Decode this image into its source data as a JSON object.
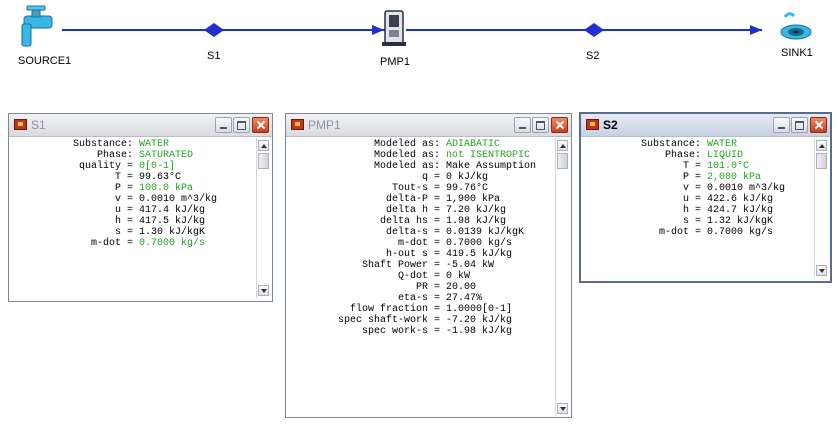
{
  "flowsheet": {
    "nodes": [
      {
        "label": "SOURCE1",
        "icon": "faucet-icon"
      },
      {
        "label": "S1",
        "icon": "stream-diamond-icon"
      },
      {
        "label": "PMP1",
        "icon": "pump-icon"
      },
      {
        "label": "S2",
        "icon": "stream-diamond-icon"
      },
      {
        "label": "SINK1",
        "icon": "drain-icon"
      }
    ],
    "line_color": "#1f2fd1"
  },
  "windows": {
    "s1": {
      "title": "S1",
      "rows": [
        {
          "label": "Substance:",
          "value": "WATER"
        },
        {
          "label": "Phase:",
          "value": "SATURATED"
        },
        {
          "label": "quality =",
          "value": "0[0-1]"
        },
        {
          "label": "T =",
          "value": "99.63°C"
        },
        {
          "label": "P =",
          "value": "100.0 kPa"
        },
        {
          "label": "v =",
          "value": "0.0010 m^3/kg"
        },
        {
          "label": "u =",
          "value": "417.4 kJ/kg"
        },
        {
          "label": "h =",
          "value": "417.5 kJ/kg"
        },
        {
          "label": "s =",
          "value": "1.30 kJ/kgK"
        },
        {
          "label": "m-dot =",
          "value": "0.7000 kg/s"
        }
      ]
    },
    "pmp1": {
      "title": "PMP1",
      "rows": [
        {
          "label": "Modeled as:",
          "value": "ADIABATIC"
        },
        {
          "label": "Modeled as:",
          "value": "not ISENTROPIC"
        },
        {
          "label": "Modeled as:",
          "value": "Make Assumption"
        },
        {
          "label": "q =",
          "value": "0 kJ/kg"
        },
        {
          "label": "Tout-s =",
          "value": "99.76°C"
        },
        {
          "label": "delta-P =",
          "value": "1,900 kPa"
        },
        {
          "label": "delta h =",
          "value": "7.20 kJ/kg"
        },
        {
          "label": "delta hs =",
          "value": "1.98 kJ/kg"
        },
        {
          "label": "delta-s =",
          "value": "0.0139 kJ/kgK"
        },
        {
          "label": "m-dot =",
          "value": "0.7000 kg/s"
        },
        {
          "label": "h-out s =",
          "value": "419.5 kJ/kg"
        },
        {
          "label": "Shaft Power =",
          "value": "-5.04 kW"
        },
        {
          "label": "Q-dot =",
          "value": "0 kW"
        },
        {
          "label": "PR =",
          "value": "20.00"
        },
        {
          "label": "eta-s =",
          "value": "27.47%"
        },
        {
          "label": "flow fraction =",
          "value": "1.0000[0-1]"
        },
        {
          "label": "spec shaft-work =",
          "value": "-7.20 kJ/kg"
        },
        {
          "label": "spec work-s =",
          "value": "-1.98 kJ/kg"
        }
      ]
    },
    "s2": {
      "title": "S2",
      "rows": [
        {
          "label": "Substance:",
          "value": "WATER"
        },
        {
          "label": "Phase:",
          "value": "LIQUID"
        },
        {
          "label": "T =",
          "value": "101.0°C"
        },
        {
          "label": "P =",
          "value": "2,000 kPa"
        },
        {
          "label": "v =",
          "value": "0.0010 m^3/kg"
        },
        {
          "label": "u =",
          "value": "422.6 kJ/kg"
        },
        {
          "label": "h =",
          "value": "424.7 kJ/kg"
        },
        {
          "label": "s =",
          "value": "1.32 kJ/kgK"
        },
        {
          "label": "m-dot =",
          "value": "0.7000 kg/s"
        }
      ]
    }
  },
  "colors": {
    "input_value": "#1ea61e",
    "computed_value": "#000000"
  }
}
